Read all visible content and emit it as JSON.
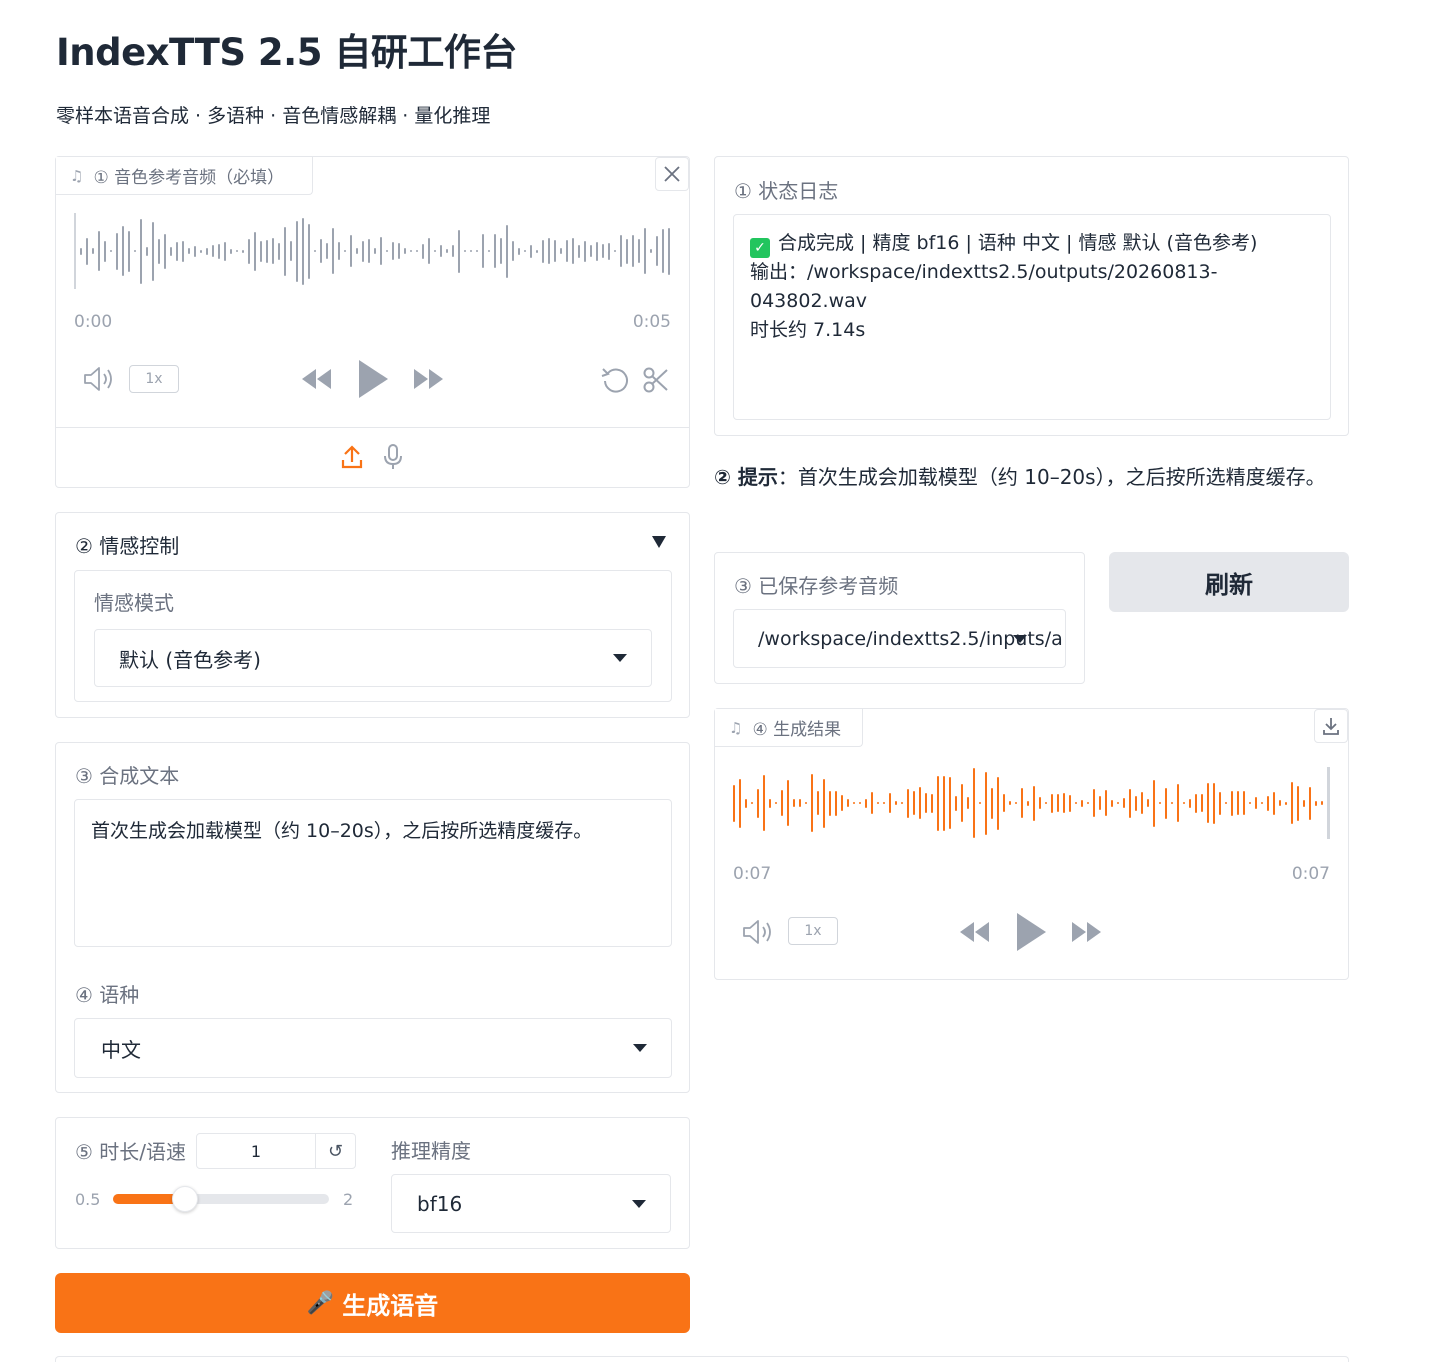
{
  "header": {
    "title": "IndexTTS 2.5 自研工作台",
    "subtitle": "零样本语音合成 · 多语种 · 音色情感解耦 · 量化推理"
  },
  "reference_audio": {
    "label": "① 音色参考音频（必填）",
    "time_start": "0:00",
    "time_end": "0:05",
    "speed": "1x",
    "icons": [
      "music-note-icon",
      "close-icon",
      "volume-icon",
      "rewind-icon",
      "play-icon",
      "fast-forward-icon",
      "undo-icon",
      "scissors-icon",
      "upload-icon",
      "microphone-icon"
    ]
  },
  "emotion": {
    "label": "② 情感控制",
    "mode_label": "情感模式",
    "mode_value": "默认 (音色参考)"
  },
  "text_input": {
    "label": "③ 合成文本",
    "value": "首次生成会加载模型（约 10–20s），之后按所选精度缓存。"
  },
  "language": {
    "label": "④ 语种",
    "value": "中文"
  },
  "speed": {
    "label": "⑤ 时长/语速",
    "value": "1",
    "reset_icon": "↺",
    "min": "0.5",
    "max": "2",
    "fraction": 0.333
  },
  "precision": {
    "label": "推理精度",
    "value": "bf16"
  },
  "generate_button": {
    "icon": "🎤",
    "label": "生成语音"
  },
  "status_log": {
    "label": "① 状态日志",
    "line1": "合成完成 | 精度 bf16 | 语种 中文 | 情感 默认 (音色参考)",
    "line2": "输出：/workspace/indextts2.5/outputs/20260813-043802.wav",
    "line3": "时长约 7.14s"
  },
  "hint": {
    "prefix": "② 提示",
    "text": "：首次生成会加载模型（约 10–20s），之后按所选精度缓存。"
  },
  "saved_audio": {
    "label": "③ 已保存参考音频",
    "value": "/workspace/indextts2.5/inputs/a"
  },
  "refresh_button": {
    "label": "刷新"
  },
  "result_audio": {
    "label": "④ 生成结果",
    "time_start": "0:07",
    "time_end": "0:07",
    "speed": "1x"
  },
  "colors": {
    "accent": "#f97316",
    "wave_gray": "#9ca3af",
    "success": "#22c55e"
  }
}
